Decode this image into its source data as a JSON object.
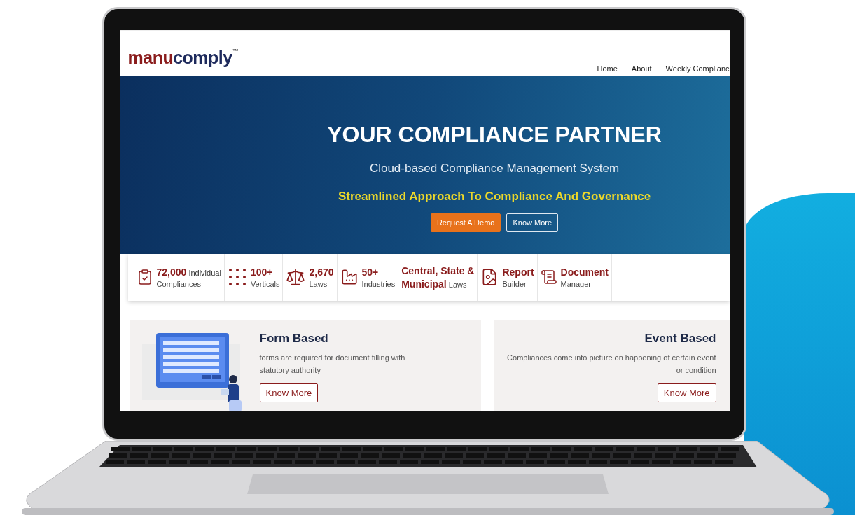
{
  "logo": {
    "primary": "manu",
    "secondary": "comply",
    "mark": "™"
  },
  "nav": [
    {
      "label": "Home"
    },
    {
      "label": "About"
    },
    {
      "label": "Weekly Complianc"
    }
  ],
  "hero": {
    "title": "YOUR COMPLIANCE PARTNER",
    "subtitle": "Cloud-based Compliance Management System",
    "tagline": "Streamlined Approach To Compliance And Governance",
    "buttons": [
      {
        "label": "Request A Demo",
        "kind": "primary"
      },
      {
        "label": "Know More",
        "kind": "outline"
      }
    ]
  },
  "stats": [
    {
      "kind": "clipboard",
      "line1": "**72,000** Individual",
      "line2": "Compliances"
    },
    {
      "kind": "dots",
      "line1": "**100+**",
      "line2": "Verticals"
    },
    {
      "kind": "scales",
      "line1": "**2,670**",
      "line2": "Laws"
    },
    {
      "kind": "factory",
      "line1": "**50+**",
      "line2": "Industries"
    },
    {
      "kind": "text",
      "line1": "**Central, State &**",
      "line2": "**Municipal** Laws"
    },
    {
      "kind": "report",
      "line1": "**Report**",
      "line2": "Builder"
    },
    {
      "kind": "document",
      "line1": "**Document**",
      "line2": "Manager"
    }
  ],
  "cards": [
    {
      "kind": "illustrated",
      "title": "Form Based",
      "text": "forms are required for document filling with statutory authority",
      "button": "Know More"
    },
    {
      "kind": "plain",
      "title": "Event Based",
      "text": "Compliances come into picture on happening of certain event or condition",
      "button": "Know More"
    }
  ]
}
